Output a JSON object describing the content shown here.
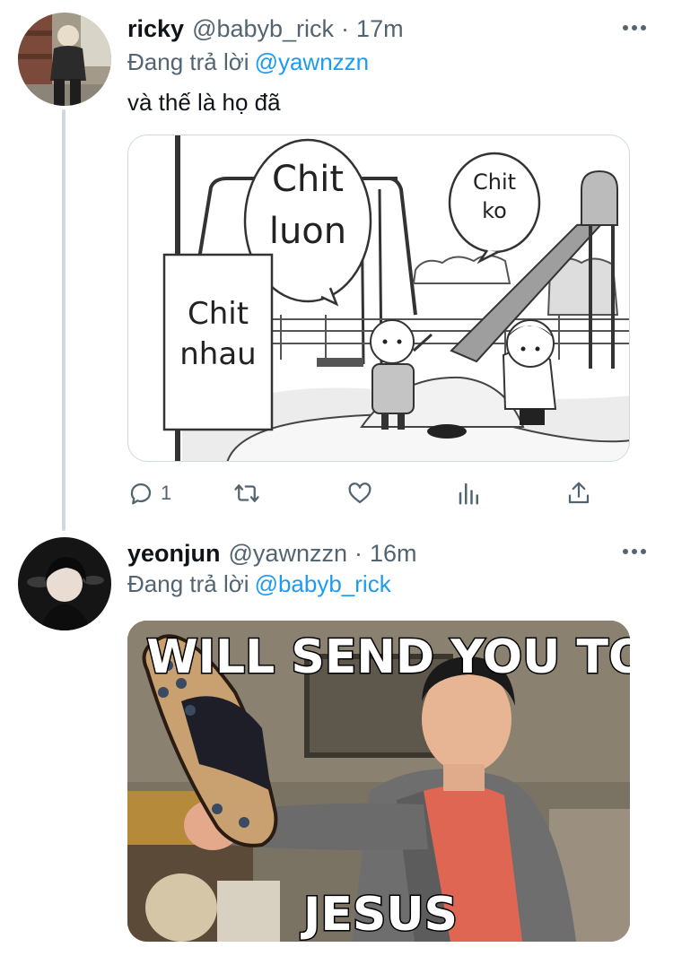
{
  "tweets": [
    {
      "name": "ricky",
      "handle": "@babyb_rick",
      "separator": "·",
      "time": "17m",
      "replying_prefix": "Đang trả lời",
      "replying_to": "@yawnzzn",
      "text": "và thế là họ đã",
      "media": {
        "bubble_big_line1": "Chit",
        "bubble_big_line2": "luon",
        "bubble_small_line1": "Chit",
        "bubble_small_line2": "ko",
        "sign_line1": "Chit",
        "sign_line2": "nhau"
      },
      "actions": {
        "reply_count": "1"
      }
    },
    {
      "name": "yeonjun",
      "handle": "@yawnzzn",
      "separator": "·",
      "time": "16m",
      "replying_prefix": "Đang trả lời",
      "replying_to": "@babyb_rick",
      "media": {
        "caption_top": "I WILL SEND YOU TO",
        "caption_bottom": "JESUS"
      }
    }
  ],
  "colors": {
    "text_primary": "#0f1419",
    "text_secondary": "#536471",
    "link": "#1d9bf0",
    "thread_line": "#cfd9de"
  },
  "icons": [
    "more-icon",
    "reply-icon",
    "retweet-icon",
    "like-icon",
    "stats-icon",
    "share-icon"
  ]
}
